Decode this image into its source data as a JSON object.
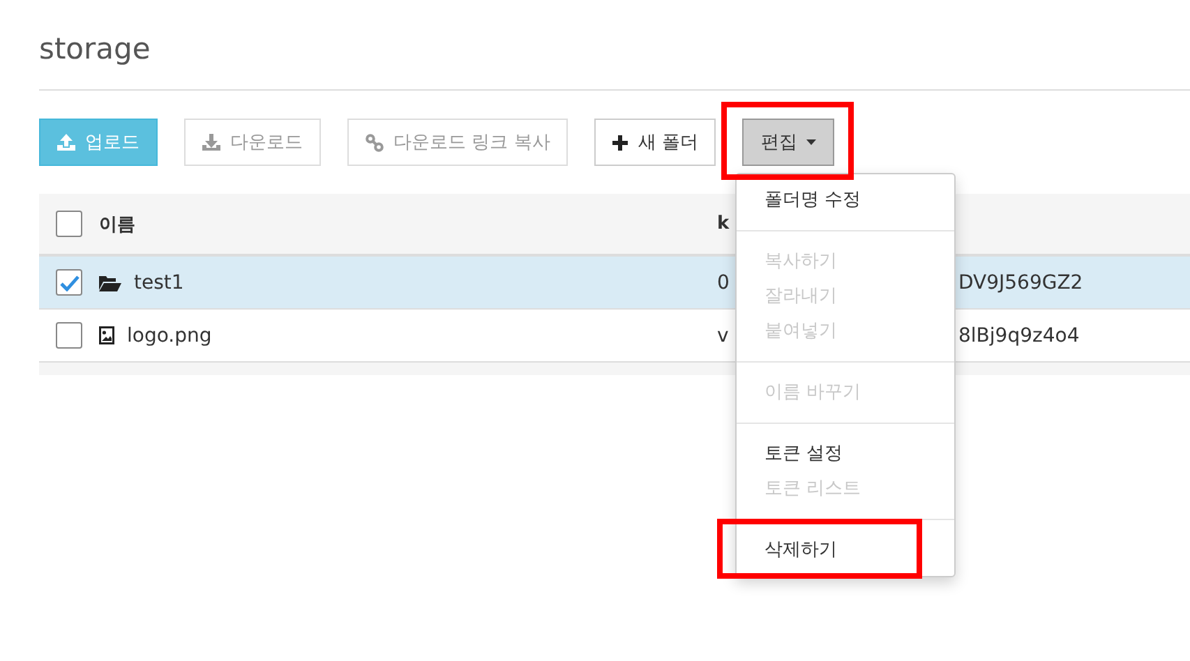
{
  "title": "storage",
  "toolbar": [
    {
      "label": "업로드",
      "kind": "upload",
      "disabled": false,
      "highlighted": false
    },
    {
      "label": "다운로드",
      "kind": "download",
      "disabled": true,
      "highlighted": false
    },
    {
      "label": "다운로드 링크 복사",
      "kind": "link",
      "disabled": true,
      "highlighted": false
    },
    {
      "label": "새 폴더",
      "kind": "new-folder",
      "disabled": false,
      "highlighted": false
    },
    {
      "label": "편집",
      "kind": "dropdown",
      "disabled": false,
      "highlighted": true
    }
  ],
  "table": {
    "columns": [
      "이름",
      "k"
    ],
    "header_checked": false,
    "rows": [
      {
        "name": "test1",
        "kind": "folder",
        "selected": true,
        "key_head": "0",
        "key_tail": "DV9J569GZ2"
      },
      {
        "name": "logo.png",
        "kind": "image",
        "selected": false,
        "key_head": "v",
        "key_tail": "8lBj9q9z4o4"
      }
    ]
  },
  "menu": [
    {
      "kind": "item",
      "label": "폴더명 수정",
      "disabled": false,
      "highlighted": false
    },
    {
      "kind": "divider"
    },
    {
      "kind": "item",
      "label": "복사하기",
      "disabled": true,
      "highlighted": false
    },
    {
      "kind": "item",
      "label": "잘라내기",
      "disabled": true,
      "highlighted": false
    },
    {
      "kind": "item",
      "label": "붙여넣기",
      "disabled": true,
      "highlighted": false
    },
    {
      "kind": "divider"
    },
    {
      "kind": "item",
      "label": "이름 바꾸기",
      "disabled": true,
      "highlighted": false
    },
    {
      "kind": "divider"
    },
    {
      "kind": "item",
      "label": "토큰 설정",
      "disabled": false,
      "highlighted": false
    },
    {
      "kind": "item",
      "label": "토큰 리스트",
      "disabled": true,
      "highlighted": false
    },
    {
      "kind": "divider"
    },
    {
      "kind": "item",
      "label": "삭제하기",
      "disabled": false,
      "highlighted": true
    }
  ]
}
